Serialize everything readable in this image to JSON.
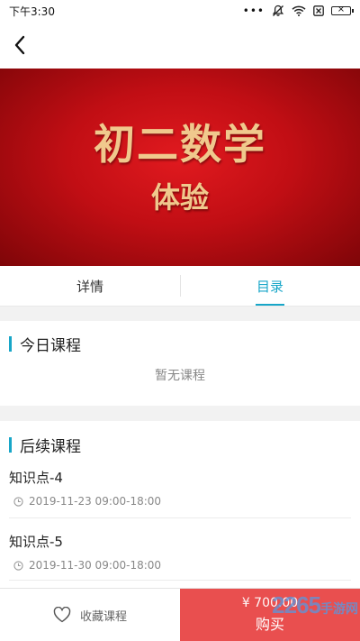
{
  "statusbar": {
    "time": "下午3:30",
    "dots": "•••"
  },
  "banner": {
    "title": "初二数学",
    "subtitle": "体验"
  },
  "tabs": [
    {
      "label": "详情",
      "active": false
    },
    {
      "label": "目录",
      "active": true
    }
  ],
  "today": {
    "title": "今日课程",
    "empty_text": "暂无课程"
  },
  "upcoming": {
    "title": "后续课程",
    "items": [
      {
        "title": "知识点-4",
        "time": "2019-11-23 09:00-18:00"
      },
      {
        "title": "知识点-5",
        "time": "2019-11-30 09:00-18:00"
      }
    ]
  },
  "bottom": {
    "favorite_label": "收藏课程",
    "price": "¥ 700.00",
    "buy_label": "购买",
    "buy_color": "#e94f4f"
  },
  "accent_color": "#18a6c8",
  "watermark": {
    "text": "2265",
    "sub": "手游网"
  }
}
